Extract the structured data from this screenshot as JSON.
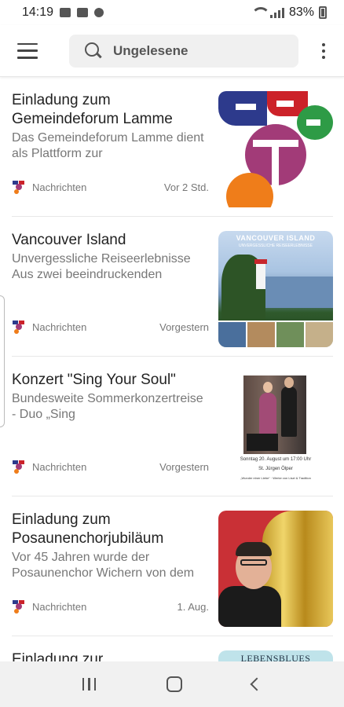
{
  "status_bar": {
    "time": "14:19",
    "battery": "83%",
    "left_icons": [
      "gallery-icon",
      "mail-icon",
      "chat-bubble-icon"
    ],
    "right_icons": [
      "wifi-icon",
      "signal-icon",
      "battery-icon"
    ]
  },
  "app_bar": {
    "search_label": "Ungelesene",
    "icons": [
      "menu-icon",
      "search-icon",
      "more-vert-icon"
    ]
  },
  "feed": [
    {
      "title": "Einladung zum Gemeindeforum Lamme",
      "description": "Das Gemeindeforum Lamme dient als Plattform zur",
      "source": "Nachrichten",
      "time": "Vor 2 Std."
    },
    {
      "title": "Vancouver Island",
      "description": "Unvergessliche Reiseerlebnisse Aus zwei beeindruckenden",
      "source": "Nachrichten",
      "time": "Vorgestern",
      "thumb_heading": "VANCOUVER ISLAND",
      "thumb_sub": "UNVERGESSLICHE REISEERLEBNISSE"
    },
    {
      "title": "Konzert \"Sing Your Soul\"",
      "description": "Bundesweite Sommerkonzertreise - Duo „Sing",
      "source": "Nachrichten",
      "time": "Vorgestern",
      "thumb_caption_1": "Sonntag 20. August um 17:00 Uhr",
      "thumb_caption_2": "St. Jürgen Ölper",
      "thumb_caption_3": "„Wunder einer Liebe“ · Werke von Liszt & Tradition"
    },
    {
      "title": "Einladung zum Posaunenchorjubiläum",
      "description": "Vor 45 Jahren wurde der Posaunenchor Wichern von dem",
      "source": "Nachrichten",
      "time": "1. Aug."
    },
    {
      "title": "Einladung zur",
      "thumb_label": "LEBENSBLUES"
    }
  ],
  "nav": {
    "icons": [
      "recent-apps-icon",
      "home-icon",
      "back-icon"
    ]
  }
}
